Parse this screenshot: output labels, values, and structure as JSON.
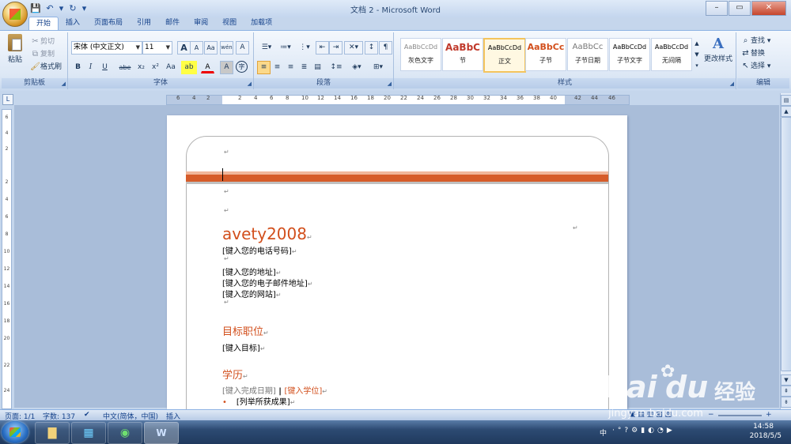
{
  "window": {
    "title": "文档 2 - Microsoft Word",
    "minimize": "–",
    "maximize": "▭",
    "close": "✕"
  },
  "qat": {
    "save": "💾",
    "undo": "↶",
    "undo_dd": "▾",
    "redo": "↻",
    "more": "▾"
  },
  "tabs": [
    "开始",
    "插入",
    "页面布局",
    "引用",
    "邮件",
    "审阅",
    "视图",
    "加载项"
  ],
  "clipboard": {
    "paste": "粘贴",
    "cut": "剪切",
    "copy": "复制",
    "format_painter": "格式刷",
    "label": "剪贴板"
  },
  "font": {
    "name": "宋体 (中文正文)",
    "size": "11",
    "grow": "A",
    "shrink": "A",
    "clear": "Aa",
    "phonetic": "wén",
    "charborder": "A",
    "bold": "B",
    "italic": "I",
    "underline": "U",
    "strike": "abe",
    "sub": "x₂",
    "sup": "x²",
    "case": "Aa",
    "highlight": "ab",
    "color": "A",
    "shade": "A",
    "enclose": "字",
    "label": "字体"
  },
  "paragraph": {
    "label": "段落"
  },
  "styles": {
    "label": "样式",
    "items": [
      {
        "sample": "AaBbCcDd",
        "name": "灰色文字"
      },
      {
        "sample": "AaBbC",
        "name": "节"
      },
      {
        "sample": "AaBbCcDd",
        "name": "正文"
      },
      {
        "sample": "AaBbCc",
        "name": "子节"
      },
      {
        "sample": "AaBbCc",
        "name": "子节日期"
      },
      {
        "sample": "AaBbCcDd",
        "name": "子节文字"
      },
      {
        "sample": "AaBbCcDd",
        "name": "无间隔"
      }
    ],
    "change": "更改样式"
  },
  "editing": {
    "find": "查找",
    "replace": "替换",
    "select": "选择",
    "label": "编辑"
  },
  "ruler": {
    "corner": "L",
    "h_numbers": [
      "6",
      "4",
      "2",
      "2",
      "4",
      "6",
      "8",
      "10",
      "12",
      "14",
      "16",
      "18",
      "20",
      "22",
      "24",
      "26",
      "28",
      "30",
      "32",
      "34",
      "36",
      "38",
      "40",
      "42",
      "44",
      "46"
    ],
    "v_numbers": [
      "6",
      "4",
      "2",
      "2",
      "4",
      "6",
      "8",
      "10",
      "12",
      "14",
      "16",
      "18",
      "20",
      "22",
      "24"
    ]
  },
  "document": {
    "para_mark": "↵",
    "name": "avety2008",
    "phone": "[键入您的电话号码]",
    "address": "[键入您的地址]",
    "email": "[键入您的电子邮件地址]",
    "website": "[键入您的网站]",
    "objective_heading": "目标职位",
    "objective": "[键入目标]",
    "education_heading": "学历",
    "edu_date": "[键入完成日期]",
    "edu_sep": " | ",
    "edu_degree": "[键入学位]",
    "bullet": "•",
    "achievements": "[列举所获成果]"
  },
  "status": {
    "page": "页面: 1/1",
    "words": "字数: 137",
    "language": "中文(简体，中国)",
    "insert": "插入",
    "zoom_minus": "−",
    "zoom_plus": "+"
  },
  "taskbar": {
    "lang": "中",
    "time": "14:58",
    "date": "2018/5/5"
  },
  "watermark": {
    "brand": "Bai",
    "brand2": "du",
    "cn": "经验",
    "url": "jingyan.baidu.com"
  }
}
